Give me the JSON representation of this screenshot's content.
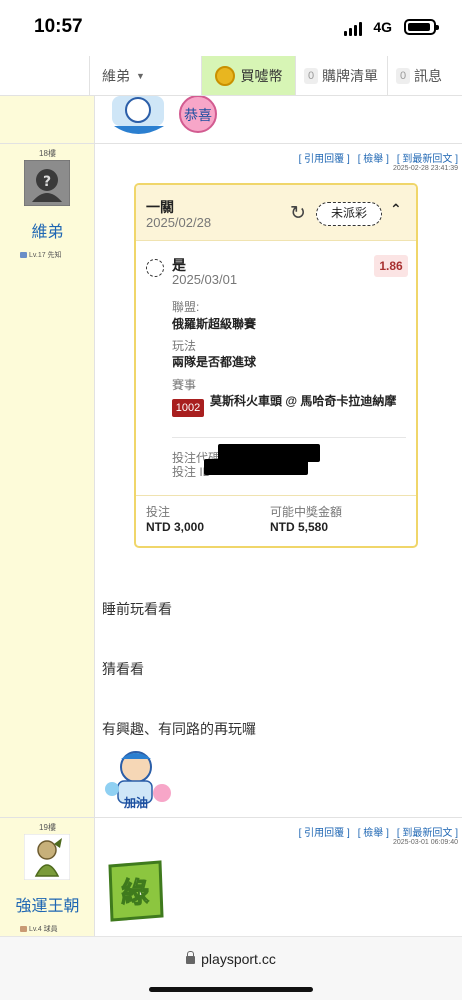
{
  "status_bar": {
    "time": "10:57",
    "network": "4G"
  },
  "nav": {
    "user": "維弟",
    "coin_icon_label": "嘘",
    "coin": "買噓幣",
    "cart_count": "0",
    "cart": "購牌清單",
    "msg_count": "0",
    "msg": "訊息"
  },
  "posts": [
    {
      "floor": "18樓",
      "username": "維弟",
      "level": "Lv.17 先知",
      "actions": [
        "[ 引用回覆 ]",
        "[ 檢舉 ]",
        "[ 到最新回文 ]"
      ],
      "date": "2025-02-28 23:41:39",
      "ticket": {
        "title": "一關",
        "date": "2025/02/28",
        "status": "未派彩",
        "pick": "是",
        "pick_date": "2025/03/01",
        "odds": "1.86",
        "league_label": "聯盟:",
        "league": "俄羅斯超級聯賽",
        "play_label": "玩法",
        "play": "兩隊是否都進球",
        "event_label": "賽事",
        "event_code": "1002",
        "event": "莫斯科火車頭 @ 馬哈奇卡拉迪納摩",
        "bet_code_label": "投注代碼:",
        "bet_id_label": "投注 ID",
        "stake_label": "投注",
        "stake": "NTD 3,000",
        "payout_label": "可能中獎金額",
        "payout": "NTD 5,580"
      },
      "text": [
        "睡前玩看看",
        "猜看看",
        "有興趣、有同路的再玩囉"
      ]
    },
    {
      "floor": "19樓",
      "username": "強運王朝",
      "level": "Lv.4 球員",
      "actions": [
        "[ 引用回覆 ]",
        "[ 檢舉 ]",
        "[ 到最新回文 ]"
      ],
      "date": "2025-03-01 06:09:40",
      "sticker_text": "綠"
    }
  ],
  "stickers": {
    "top": "恭喜",
    "bottom": "加油"
  },
  "browser": {
    "url": "playsport.cc"
  }
}
